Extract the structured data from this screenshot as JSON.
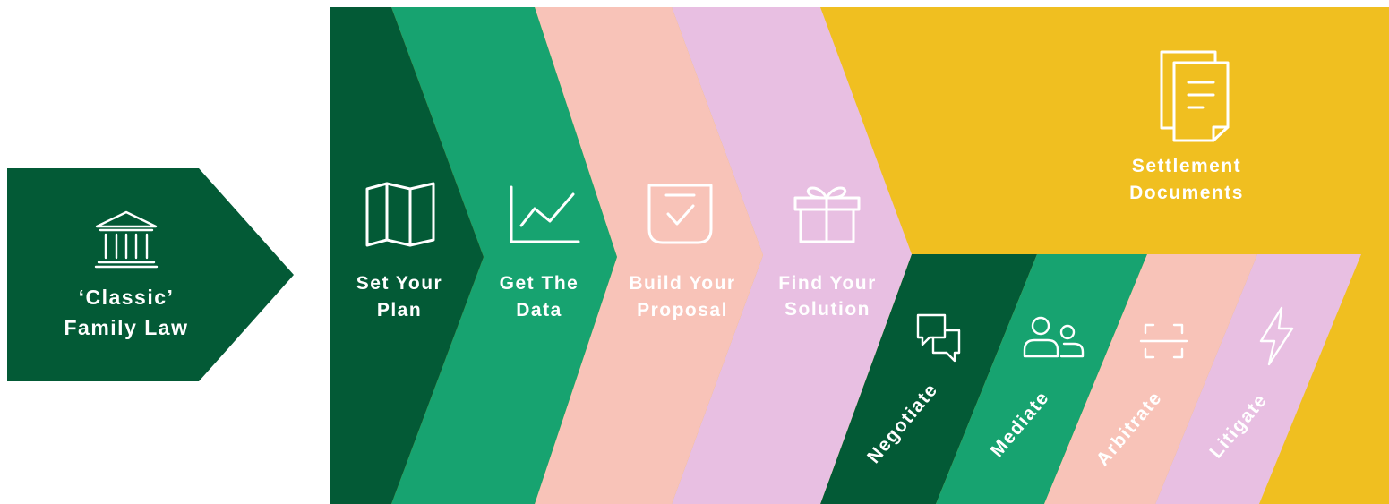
{
  "start": {
    "line1": "‘Classic’",
    "line2": "Family Law",
    "icon": "courthouse-icon"
  },
  "steps": [
    {
      "line1": "Set Your",
      "line2": "Plan",
      "icon": "map-icon"
    },
    {
      "line1": "Get The",
      "line2": "Data",
      "icon": "line-chart-icon"
    },
    {
      "line1": "Build Your",
      "line2": "Proposal",
      "icon": "checkbox-icon"
    },
    {
      "line1": "Find Your",
      "line2": "Solution",
      "icon": "gift-icon"
    }
  ],
  "outcome": {
    "line1": "Settlement",
    "line2": "Documents",
    "icon": "documents-icon"
  },
  "methods": [
    {
      "label": "Negotiate",
      "icon": "speech-bubbles-icon"
    },
    {
      "label": "Mediate",
      "icon": "people-icon"
    },
    {
      "label": "Arbitrate",
      "icon": "scan-frame-icon"
    },
    {
      "label": "Litigate",
      "icon": "lightning-icon"
    }
  ],
  "colors": {
    "dark_green": "#035a36",
    "green": "#17a370",
    "peach": "#f8c3b8",
    "lilac": "#e8bfe2",
    "yellow": "#f0bf20"
  }
}
